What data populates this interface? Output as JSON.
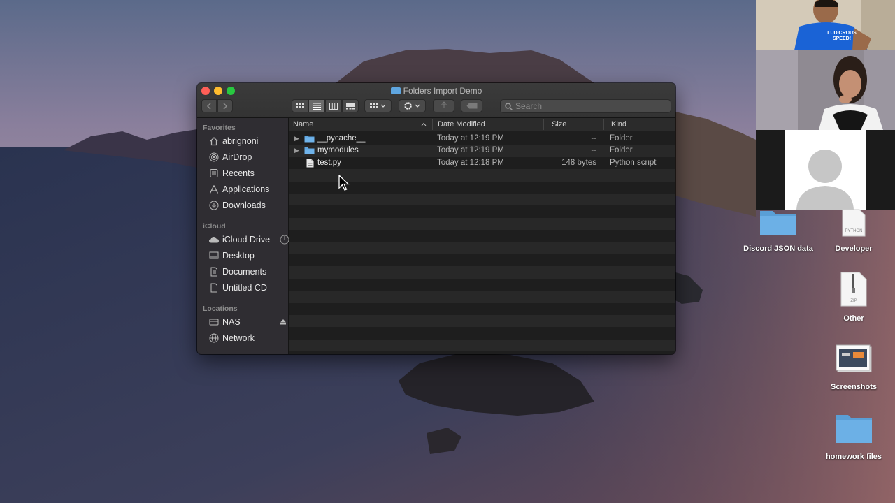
{
  "window": {
    "title": "Folders Import Demo",
    "search_placeholder": "Search"
  },
  "sidebar": {
    "favorites_label": "Favorites",
    "favorites": [
      {
        "label": "abrignoni",
        "icon": "home-icon"
      },
      {
        "label": "AirDrop",
        "icon": "airdrop-icon"
      },
      {
        "label": "Recents",
        "icon": "recents-icon"
      },
      {
        "label": "Applications",
        "icon": "applications-icon"
      },
      {
        "label": "Downloads",
        "icon": "downloads-icon"
      }
    ],
    "icloud_label": "iCloud",
    "icloud": [
      {
        "label": "iCloud Drive",
        "icon": "cloud-icon"
      },
      {
        "label": "Desktop",
        "icon": "desktop-icon"
      },
      {
        "label": "Documents",
        "icon": "document-icon"
      },
      {
        "label": "Untitled CD",
        "icon": "document-icon"
      }
    ],
    "locations_label": "Locations",
    "locations": [
      {
        "label": "NAS",
        "icon": "nas-icon"
      },
      {
        "label": "Network",
        "icon": "network-icon"
      }
    ]
  },
  "columns": {
    "name": "Name",
    "date": "Date Modified",
    "size": "Size",
    "kind": "Kind"
  },
  "files": [
    {
      "name": "__pycache__",
      "date": "Today at 12:19 PM",
      "size": "--",
      "kind": "Folder",
      "icon": "folder-icon"
    },
    {
      "name": "mymodules",
      "date": "Today at 12:19 PM",
      "size": "--",
      "kind": "Folder",
      "icon": "folder-icon"
    },
    {
      "name": "test.py",
      "date": "Today at 12:18 PM",
      "size": "148 bytes",
      "kind": "Python script",
      "icon": "python-file-icon"
    }
  ],
  "desktop_icons": [
    {
      "label": "Discord JSON data",
      "icon": "folder-icon"
    },
    {
      "label": "Developer",
      "icon": "python-file-icon"
    },
    {
      "label": "Other",
      "icon": "zip-file-icon"
    },
    {
      "label": "Screenshots",
      "icon": "screenshots-icon"
    },
    {
      "label": "homework files",
      "icon": "folder-icon"
    }
  ],
  "webcam_shirt_text": "LUDICROUS SPEED!",
  "colors": {
    "close": "#ff5f57",
    "minimize": "#febc2e",
    "maximize": "#28c840",
    "folder_blue": "#5fa6e0"
  }
}
